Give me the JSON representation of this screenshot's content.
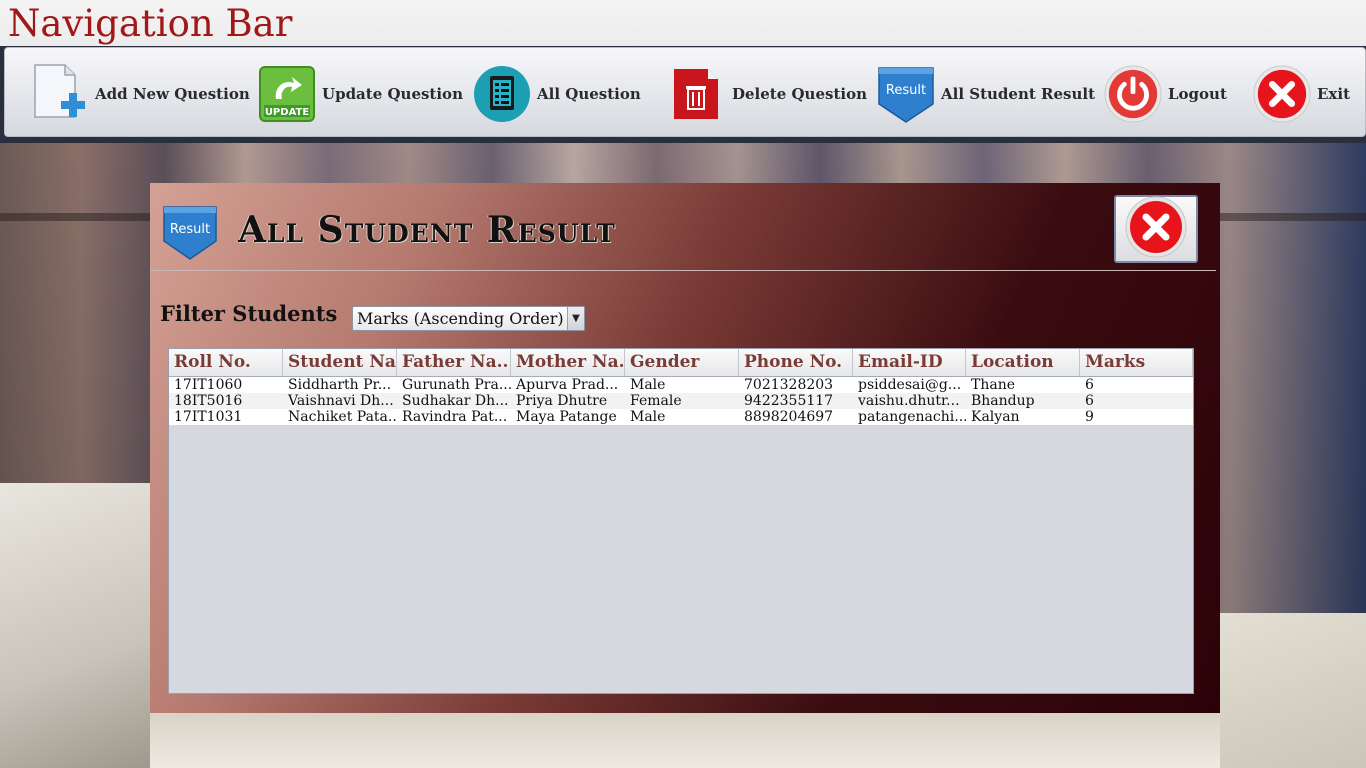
{
  "app": {
    "title": "Navigation Bar"
  },
  "nav": {
    "items": [
      {
        "label": "Add New Question",
        "icon": "add-document-icon"
      },
      {
        "label": "Update Question",
        "icon": "update-icon"
      },
      {
        "label": "All Question",
        "icon": "checklist-icon"
      },
      {
        "label": "Delete Question",
        "icon": "trash-icon"
      },
      {
        "label": "All Student Result",
        "icon": "result-badge-icon"
      },
      {
        "label": "Logout",
        "icon": "power-icon"
      },
      {
        "label": "Exit",
        "icon": "close-icon"
      }
    ],
    "result_badge_text": "Result"
  },
  "panel": {
    "title": "All Student Result",
    "badge_text": "Result",
    "filter_label": "Filter Students",
    "filter_selected": "Marks (Ascending Order)"
  },
  "table": {
    "columns": [
      "Roll No.",
      "Student Na...",
      "Father Na...",
      "Mother Na...",
      "Gender",
      "Phone No.",
      "Email-ID",
      "Location",
      "Marks"
    ],
    "rows": [
      [
        "17IT1060",
        "Siddharth Pr...",
        "Gurunath Pra...",
        "Apurva Prad...",
        "Male",
        "7021328203",
        "psiddesai@g...",
        "Thane",
        "6"
      ],
      [
        "18IT5016",
        "Vaishnavi Dh...",
        "Sudhakar Dh...",
        "Priya Dhutre",
        "Female",
        "9422355117",
        "vaishu.dhutr...",
        "Bhandup",
        "6"
      ],
      [
        "17IT1031",
        "Nachiket Pata...",
        "Ravindra Pat...",
        "Maya Patange",
        "Male",
        "8898204697",
        "patangenachi...",
        "Kalyan",
        "9"
      ]
    ]
  },
  "colors": {
    "title_red": "#a01818",
    "header_text": "#7a3a36",
    "panel_dark": "#2c0208",
    "panel_light": "#d5a195"
  }
}
